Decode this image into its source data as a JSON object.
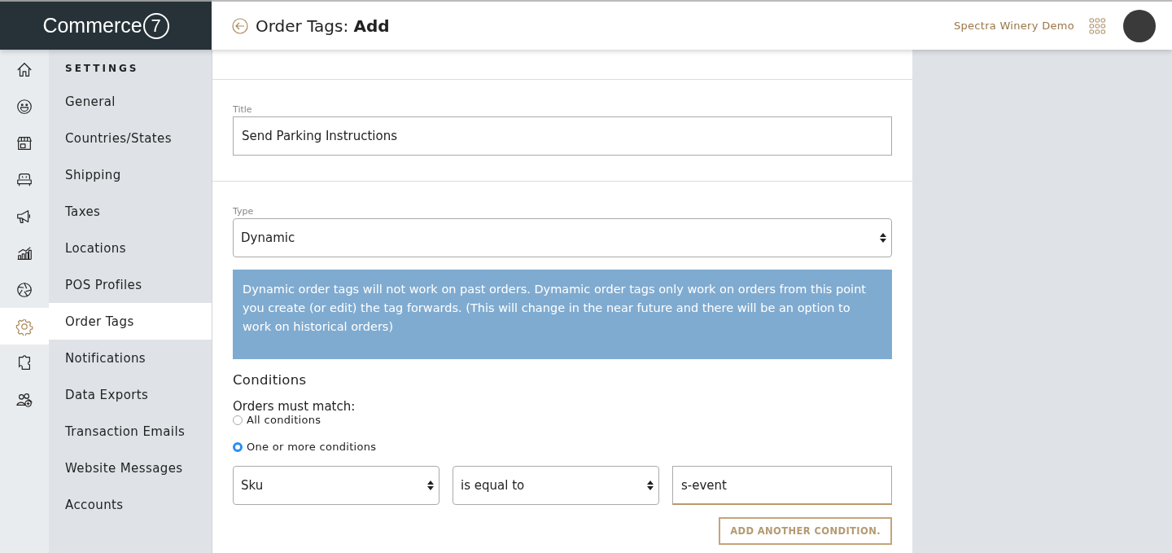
{
  "logo": {
    "text": "Commerce",
    "mark": "7"
  },
  "header": {
    "title": "Order Tags:",
    "title_strong": "Add",
    "account": "Spectra Winery Demo"
  },
  "rail": [
    {
      "selected": false
    },
    {
      "selected": false
    },
    {
      "selected": false
    },
    {
      "selected": false
    },
    {
      "selected": false
    },
    {
      "selected": false
    },
    {
      "selected": false
    },
    {
      "selected": true
    },
    {
      "selected": false
    },
    {
      "selected": false
    }
  ],
  "sidebar": {
    "heading": "SETTINGS",
    "items": [
      {
        "label": "General",
        "selected": false
      },
      {
        "label": "Countries/States",
        "selected": false
      },
      {
        "label": "Shipping",
        "selected": false
      },
      {
        "label": "Taxes",
        "selected": false
      },
      {
        "label": "Locations",
        "selected": false
      },
      {
        "label": "POS Profiles",
        "selected": false
      },
      {
        "label": "Order Tags",
        "selected": true
      },
      {
        "label": "Notifications",
        "selected": false
      },
      {
        "label": "Data Exports",
        "selected": false
      },
      {
        "label": "Transaction Emails",
        "selected": false
      },
      {
        "label": "Website Messages",
        "selected": false
      },
      {
        "label": "Accounts",
        "selected": false
      }
    ]
  },
  "form": {
    "title_label": "Title",
    "title_value": "Send Parking Instructions",
    "type_label": "Type",
    "type_value": "Dynamic",
    "notice": "Dynamic order tags will not work on past orders. Dymamic order tags only work on orders from this point you create (or edit) the tag forwards. (This will change in the near future and there will be an option to work on historical orders)",
    "conditions_heading": "Conditions",
    "match_label": "Orders must match:",
    "match_options": [
      {
        "label": "All conditions",
        "selected": false
      },
      {
        "label": "One or more conditions",
        "selected": true
      }
    ],
    "condition": {
      "field": "Sku",
      "operator": "is equal to",
      "value": "s-event"
    },
    "add_button": "ADD ANOTHER CONDITION."
  }
}
